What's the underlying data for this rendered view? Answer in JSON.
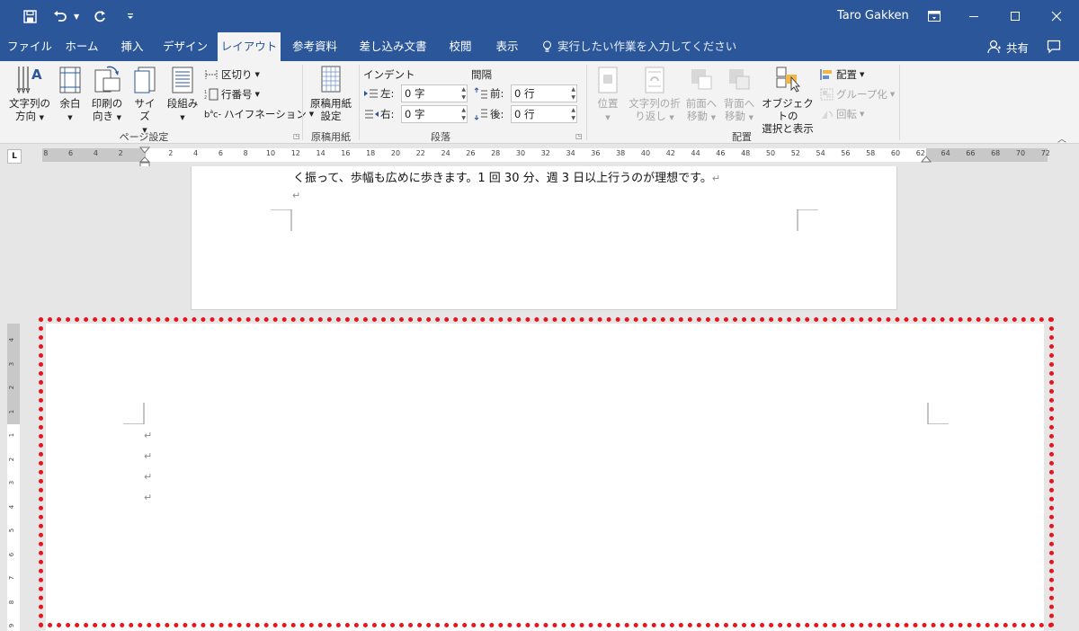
{
  "title_bar": {
    "user": "Taro Gakken",
    "qat_items": [
      "save-icon",
      "undo-icon",
      "redo-icon",
      "customize-qat-icon"
    ]
  },
  "tabs": [
    "ファイル",
    "ホーム",
    "挿入",
    "デザイン",
    "レイアウト",
    "参考資料",
    "差し込み文書",
    "校閲",
    "表示"
  ],
  "active_tab": "レイアウト",
  "tell_me": "実行したい作業を入力してください",
  "share": "共有",
  "ribbon": {
    "page_setup": {
      "label": "ページ設定",
      "text_direction": "文字列の\n方向",
      "margins": "余白",
      "orientation": "印刷の\n向き",
      "size": "サイズ",
      "columns": "段組み",
      "breaks": "区切り",
      "line_numbers": "行番号",
      "hyphenation": "ハイフネーション"
    },
    "genko": {
      "label": "原稿用紙",
      "settings": "原稿用紙\n設定"
    },
    "paragraph": {
      "label": "段落",
      "indent_title": "インデント",
      "spacing_title": "間隔",
      "indent_left_label": "左:",
      "indent_left_value": "0 字",
      "indent_right_label": "右:",
      "indent_right_value": "0 字",
      "spacing_before_label": "前:",
      "spacing_before_value": "0 行",
      "spacing_after_label": "後:",
      "spacing_after_value": "0 行"
    },
    "arrange": {
      "label": "配置",
      "position": "位置",
      "wrap_text": "文字列の折\nり返し",
      "bring_forward": "前面へ\n移動",
      "send_backward": "背面へ\n移動",
      "selection_pane": "オブジェクトの\n選択と表示",
      "align": "配置",
      "group": "グループ化",
      "rotate": "回転"
    }
  },
  "ruler": {
    "left_numbers": [
      "8",
      "6",
      "4",
      "2"
    ],
    "right_numbers": [
      "2",
      "4",
      "6",
      "8",
      "10",
      "12",
      "14",
      "16",
      "18",
      "20",
      "22",
      "24",
      "26",
      "28",
      "30",
      "32",
      "34",
      "36",
      "38",
      "40",
      "42",
      "44",
      "46",
      "48",
      "50",
      "52",
      "54",
      "56",
      "58",
      "60",
      "62",
      "64",
      "66",
      "68",
      "70",
      "72"
    ],
    "vertical_numbers": [
      "4",
      "3",
      "2",
      "1",
      "1",
      "2",
      "3",
      "4",
      "5",
      "6",
      "7",
      "8",
      "9"
    ]
  },
  "document": {
    "page1_line": "く振って、歩幅も広めに歩きます。1 回 30 分、週 3 日以上行うのが理想です。",
    "paragraph_mark": "↵"
  },
  "colors": {
    "accent": "#2b579a",
    "highlight": "#e8141e"
  }
}
